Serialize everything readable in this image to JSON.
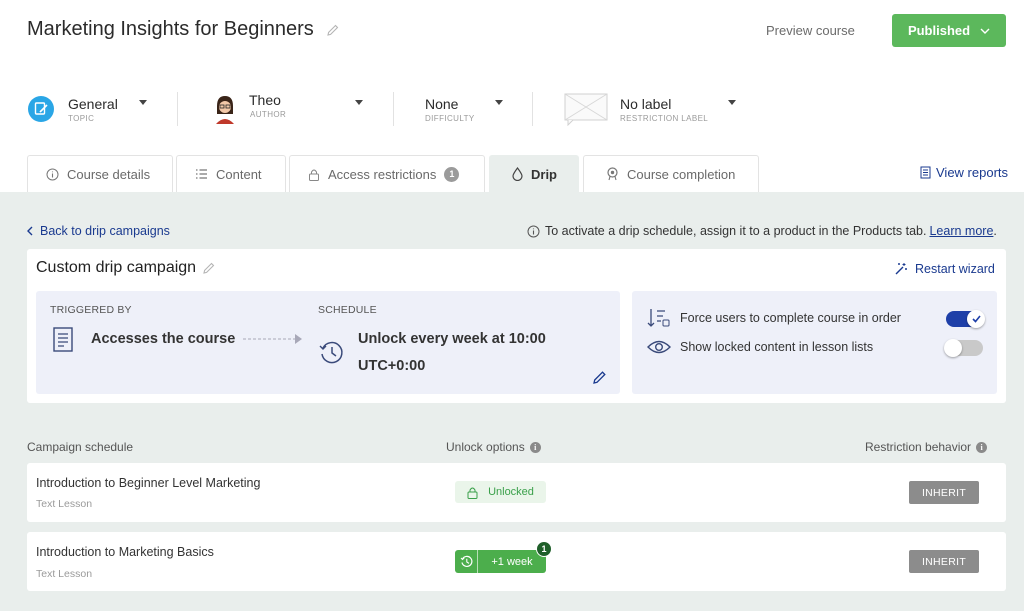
{
  "header": {
    "course_title": "Marketing Insights for Beginners",
    "preview_label": "Preview course",
    "published_label": "Published"
  },
  "meta": {
    "topic": {
      "value": "General",
      "caption": "TOPIC"
    },
    "author": {
      "value": "Theo",
      "caption": "AUTHOR"
    },
    "difficulty": {
      "value": "None",
      "caption": "DIFFICULTY"
    },
    "restriction": {
      "value": "No label",
      "caption": "RESTRICTION LABEL"
    }
  },
  "tabs": [
    {
      "label": "Course details",
      "icon": "info-icon"
    },
    {
      "label": "Content",
      "icon": "list-icon"
    },
    {
      "label": "Access restrictions",
      "icon": "lock-icon",
      "badge": "1"
    },
    {
      "label": "Drip",
      "icon": "drop-icon",
      "active": true
    },
    {
      "label": "Course completion",
      "icon": "award-icon"
    }
  ],
  "view_reports": "View reports",
  "drip": {
    "back_label": "Back to drip campaigns",
    "info_text": "To activate a drip schedule, assign it to a product in the Products tab.",
    "learn_more": "Learn more",
    "info_period": ".",
    "campaign_title": "Custom drip campaign",
    "restart_label": "Restart wizard",
    "triggered_by_label": "TRIGGERED BY",
    "trigger_value": "Accesses the course",
    "schedule_label": "SCHEDULE",
    "schedule_line1": "Unlock every week at 10:00",
    "schedule_line2": "UTC+0:00",
    "option_force": "Force users to complete course in order",
    "option_force_on": true,
    "option_locked": "Show locked content in lesson lists",
    "option_locked_on": false
  },
  "table": {
    "col_schedule": "Campaign schedule",
    "col_unlock": "Unlock options",
    "col_restriction": "Restriction behavior",
    "rows": [
      {
        "title": "Introduction to Beginner Level Marketing",
        "type": "Text Lesson",
        "unlock": "Unlocked",
        "restriction": "INHERIT"
      },
      {
        "title": "Introduction to Marketing Basics",
        "type": "Text Lesson",
        "unlock": "+1 week",
        "count": "1",
        "restriction": "INHERIT"
      }
    ]
  },
  "colors": {
    "accent": "#5cb85c",
    "link": "#1a3a8f",
    "toggle_on": "#1e3fa8",
    "panel": "#e9eeec"
  }
}
